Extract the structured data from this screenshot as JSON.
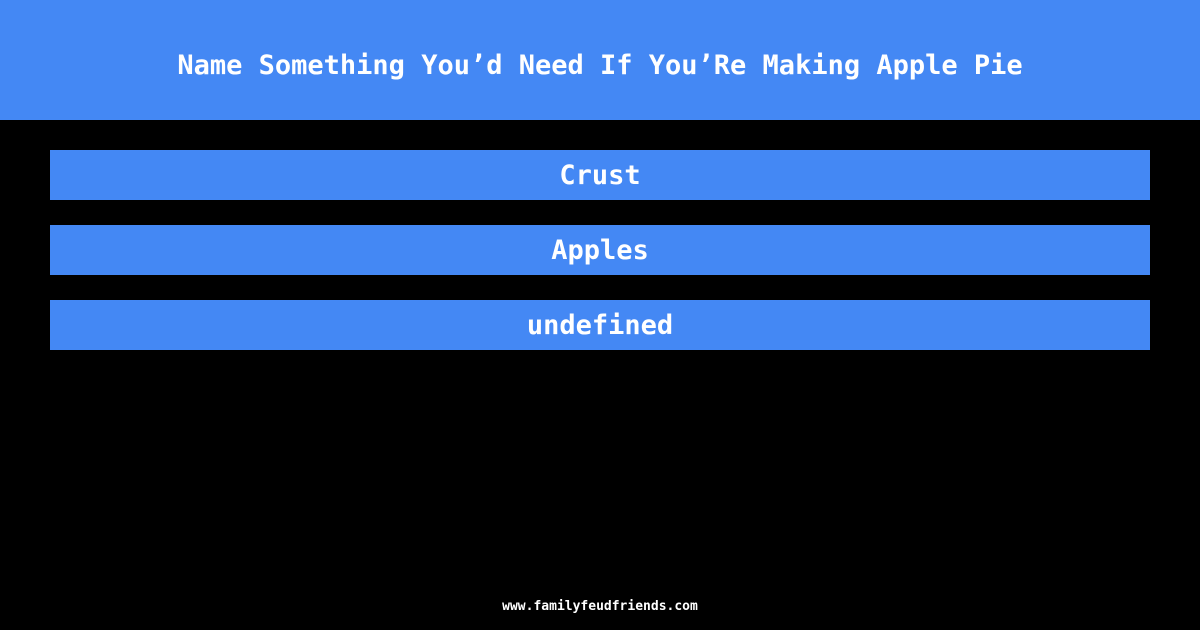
{
  "question": {
    "title": "Name Something You’d Need If You’Re Making Apple Pie"
  },
  "answers": [
    {
      "label": "Crust"
    },
    {
      "label": "Apples"
    },
    {
      "label": "undefined"
    }
  ],
  "footer": {
    "url": "www.familyfeudfriends.com"
  },
  "colors": {
    "accent": "#4488f4",
    "background": "#000000",
    "text": "#ffffff"
  }
}
